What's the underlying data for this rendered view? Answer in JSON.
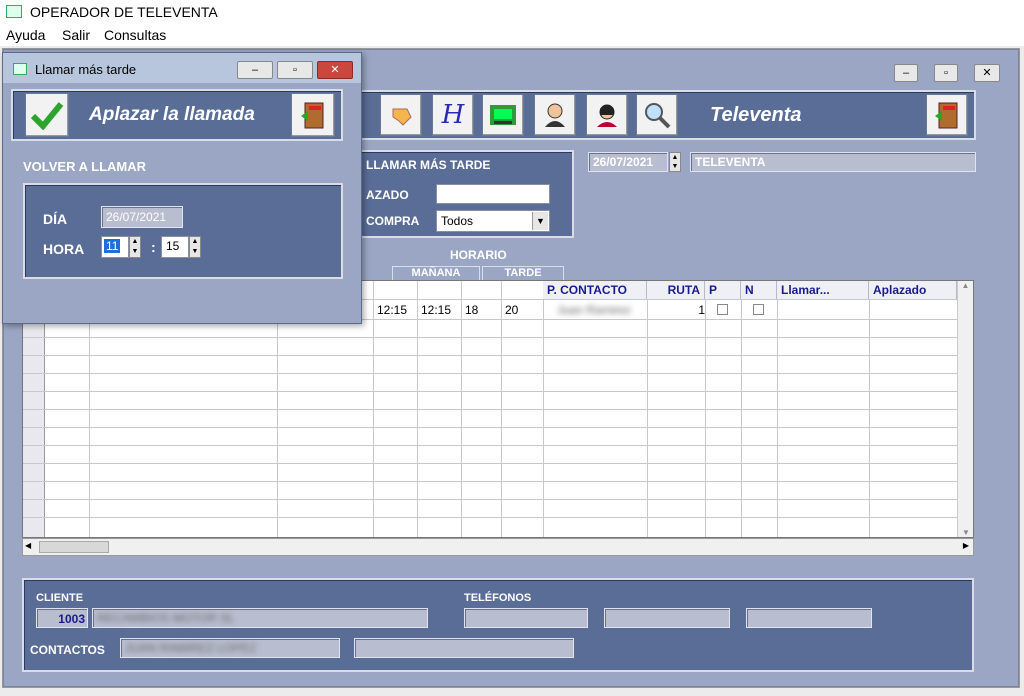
{
  "app": {
    "title": "OPERADOR DE TELEVENTA"
  },
  "menu": {
    "items": [
      "Ayuda",
      "Salir",
      "Consultas"
    ]
  },
  "main": {
    "header_title": "Televenta",
    "date": "26/07/2021",
    "televenta_field": "TELEVENTA",
    "llamar_group": {
      "title": "LLAMAR MÁS TARDE",
      "aplazado_label": "AZADO",
      "compra_label": "COMPRA",
      "compra_value": "Todos"
    },
    "horario": {
      "title": "HORARIO",
      "manana": "MAÑANA",
      "tarde": "TARDE"
    },
    "grid": {
      "headers": {
        "contacto": "P. CONTACTO",
        "ruta": "RUTA",
        "p": "P",
        "n": "N",
        "llamar": "Llamar...",
        "aplazado": "Aplazado"
      },
      "row1": {
        "h1": "12:15",
        "h2": "12:15",
        "h3": "18",
        "h4": "20",
        "contacto": "Juan Ramirez",
        "ruta": "1"
      }
    },
    "bottom": {
      "cliente_label": "CLIENTE",
      "cliente_code": "1003",
      "cliente_name": "RECAMBIOS MOTOR SL",
      "telefonos_label": "TELÉFONOS",
      "contactos_label": "CONTACTOS",
      "contacto_value": "JUAN RAMIREZ LOPEZ"
    }
  },
  "dialog": {
    "title": "Llamar más tarde",
    "header": "Aplazar la llamada",
    "section": "VOLVER A LLAMAR",
    "dia_label": "DÍA",
    "dia_value": "26/07/2021",
    "hora_label": "HORA",
    "hora_value": "11",
    "minuto_value": "15",
    "sep": ":"
  },
  "icons": {
    "exit": "exit-door-icon",
    "check": "checkmark-icon",
    "search": "magnifier-icon"
  },
  "colors": {
    "panel": "#5a6d97",
    "background": "#9aa6c4",
    "header_text": "#1a1a8c"
  }
}
